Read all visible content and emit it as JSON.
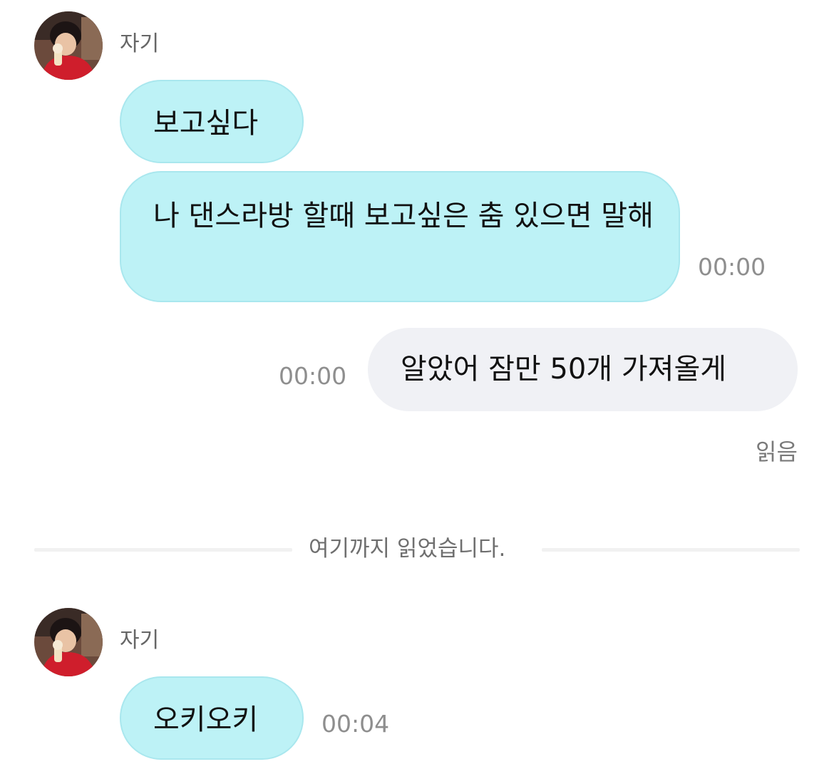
{
  "thread": {
    "group1": {
      "sender_name": "자기",
      "messages": [
        {
          "text": "보고싶다"
        },
        {
          "text": "나 댄스라방 할때 보고싶은 춤 있으면 말해",
          "time": "00:00"
        }
      ]
    },
    "outgoing": {
      "text": "알았어 잠만 50개 가져올게",
      "time": "00:00",
      "status": "읽음"
    },
    "divider": {
      "text": "여기까지 읽었습니다."
    },
    "group2": {
      "sender_name": "자기",
      "messages": [
        {
          "text": "오키오키",
          "time": "00:04"
        }
      ]
    }
  },
  "colors": {
    "incoming_bubble": "#bdf2f6",
    "incoming_border": "#a9e7ee",
    "outgoing_bubble": "#f0f1f5",
    "timestamp": "#8e8e8e",
    "background": "#ffffff"
  },
  "icons": {
    "avatar": "profile-photo"
  }
}
